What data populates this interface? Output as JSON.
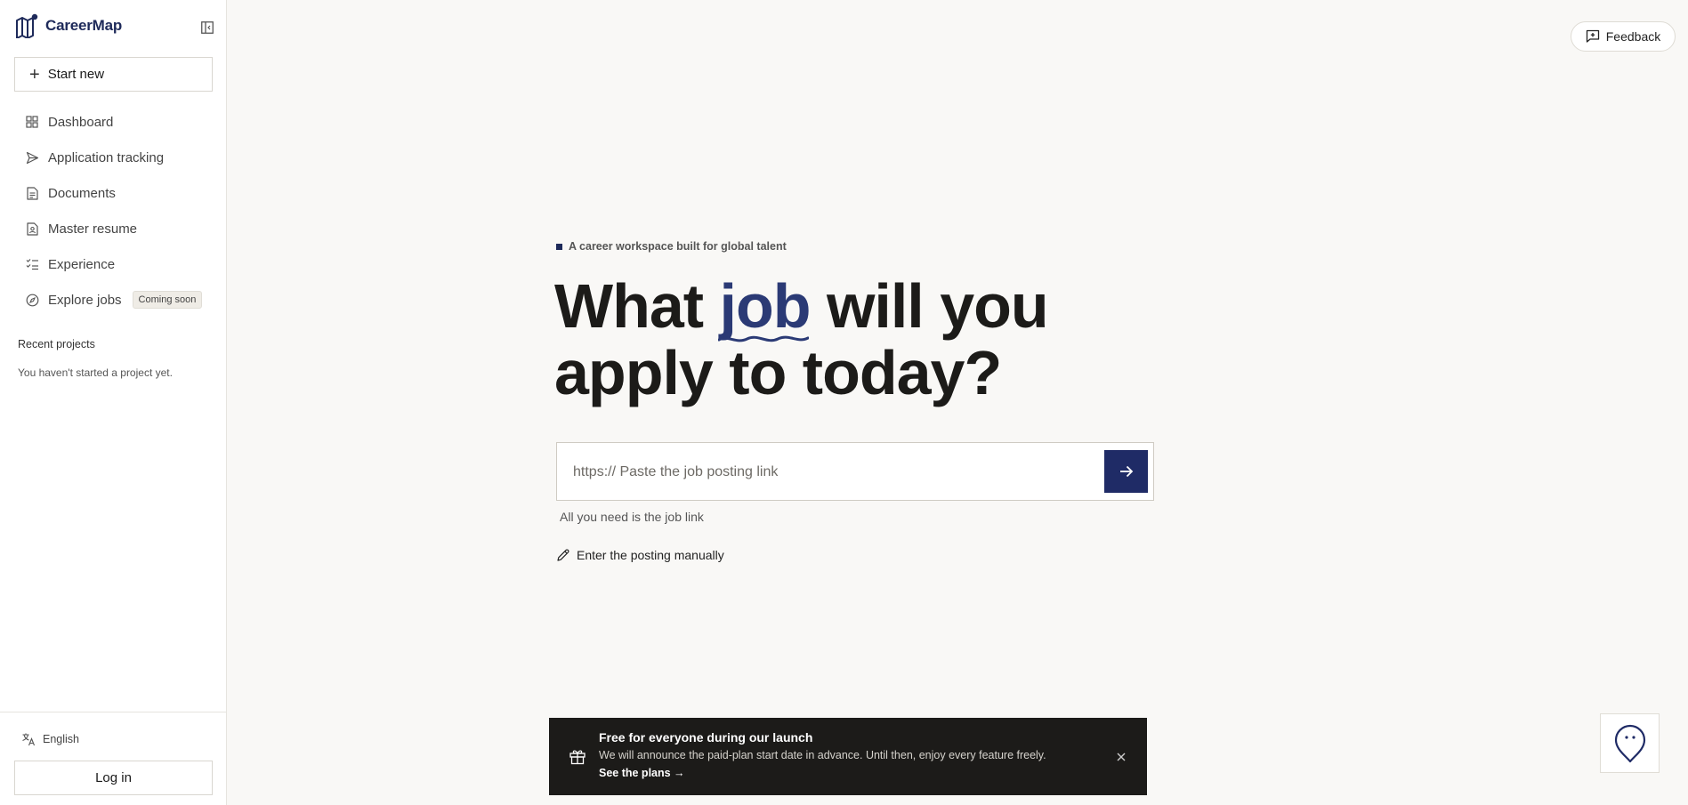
{
  "app": {
    "name": "CareerMap"
  },
  "sidebar": {
    "start_new_label": "Start new",
    "items": [
      {
        "label": "Dashboard",
        "icon": "dashboard-icon"
      },
      {
        "label": "Application tracking",
        "icon": "send-icon"
      },
      {
        "label": "Documents",
        "icon": "document-icon"
      },
      {
        "label": "Master resume",
        "icon": "resume-icon"
      },
      {
        "label": "Experience",
        "icon": "checklist-icon"
      },
      {
        "label": "Explore jobs",
        "icon": "compass-icon",
        "badge": "Coming soon"
      }
    ],
    "recent_projects_title": "Recent projects",
    "recent_projects_empty": "You haven't started a project yet.",
    "language": "English",
    "login_label": "Log in"
  },
  "header": {
    "feedback_label": "Feedback"
  },
  "hero": {
    "eyebrow": "A career workspace built for global talent",
    "headline_before": "What ",
    "headline_highlight": "job",
    "headline_after_line1": " will you",
    "headline_line2": "apply to today?",
    "input_placeholder": "https:// Paste the job posting link",
    "input_value": "",
    "hint": "All you need is the job link",
    "manual_label": "Enter the posting manually"
  },
  "banner": {
    "title": "Free for everyone during our launch",
    "body": "We will announce the paid-plan start date in advance. Until then, enjoy every feature freely.",
    "link": "See the plans →"
  },
  "colors": {
    "brand_navy": "#1f2b66",
    "highlight": "#2b3a75",
    "background": "#f9f8f6",
    "banner_bg": "#1c1b19"
  }
}
